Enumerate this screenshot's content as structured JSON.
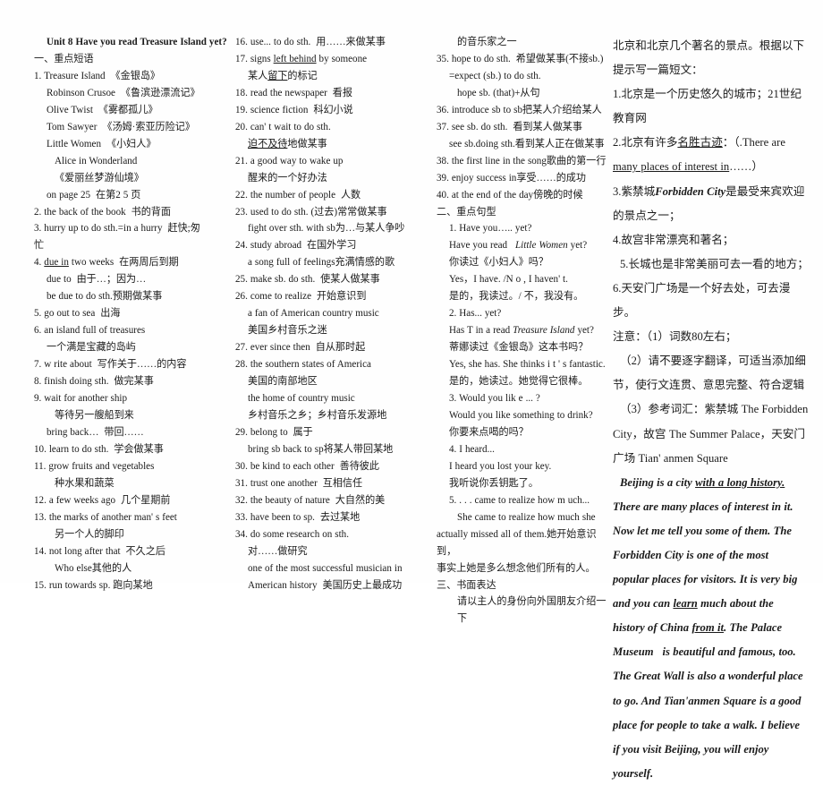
{
  "document": {
    "title": "Unit 8 Have you read Treasure Island yet?",
    "type": "english-study-notes",
    "language": "en-zh"
  },
  "col1": {
    "lines": [
      {
        "id": "l1",
        "text": "Unit 8 Have you read Treasure Island yet?",
        "style": "bold",
        "indent": 1
      },
      {
        "id": "l2",
        "text": "一、重点短语"
      },
      {
        "id": "l3",
        "text": "1. Treasure Island  《金银岛》"
      },
      {
        "id": "l4",
        "text": "Robinson Crusoe  《鲁滨逊漂流记》",
        "indent": 1
      },
      {
        "id": "l5",
        "text": "Olive Twist  《雾都孤儿》",
        "indent": 1
      },
      {
        "id": "l6",
        "text": "Tom Sawyer  《汤姆·索亚历险记》",
        "indent": 1
      },
      {
        "id": "l7",
        "text": "Little Women  《小妇人》",
        "indent": 1
      },
      {
        "id": "l8",
        "text": "Alice in Wonderland",
        "indent": 2
      },
      {
        "id": "l9",
        "text": "《爱丽丝梦游仙境》",
        "indent": 2
      },
      {
        "id": "l10",
        "text": "on page 25  在第2 5 页",
        "indent": 1
      },
      {
        "id": "l11",
        "text": "2. the back of the book  书的背面"
      },
      {
        "id": "l12",
        "text": "3. hurry up to do sth.=in a hurry  赶快;匆"
      },
      {
        "id": "l13",
        "text": "忙"
      },
      {
        "id": "l14",
        "text": "4. due in two weeks  在两周后到期",
        "underline_part": "due in"
      },
      {
        "id": "l15",
        "text": "due to  由于…；因为…",
        "indent": 1
      },
      {
        "id": "l16",
        "text": "be due to do sth.预期做某事",
        "indent": 1
      },
      {
        "id": "l17",
        "text": "5. go out to sea  出海"
      },
      {
        "id": "l18",
        "text": "6. an island full of treasures"
      },
      {
        "id": "l19",
        "text": "一个满是宝藏的岛屿",
        "indent": 1
      },
      {
        "id": "l20",
        "text": "7. w rite about  写作关于……的内容"
      },
      {
        "id": "l21",
        "text": "8. finish doing sth.  做完某事"
      },
      {
        "id": "l22",
        "text": "9. wait for another ship"
      },
      {
        "id": "l23",
        "text": "等待另一艘船到来",
        "indent": 2
      },
      {
        "id": "l24",
        "text": "bring back…  带回……",
        "indent": 1
      },
      {
        "id": "l25",
        "text": "10. learn to do sth.  学会做某事"
      },
      {
        "id": "l26",
        "text": "11. grow fruits and vegetables"
      },
      {
        "id": "l27",
        "text": "种水果和蔬菜",
        "indent": 2
      },
      {
        "id": "l28",
        "text": "12. a few weeks ago  几个星期前"
      },
      {
        "id": "l29",
        "text": "13. the marks of another man' s feet"
      },
      {
        "id": "l30",
        "text": "另一个人的脚印",
        "indent": 2
      },
      {
        "id": "l31",
        "text": "14. not long after that  不久之后"
      },
      {
        "id": "l32",
        "text": "Who else其他的人",
        "indent": 2
      },
      {
        "id": "l33",
        "text": "15. run towards sp. 跑向某地"
      }
    ]
  },
  "col2": {
    "lines": [
      {
        "id": "m1",
        "text": "16. use... to do sth.  用……来做某事"
      },
      {
        "id": "m2",
        "text": "17. signs left behind by someone",
        "underline_part": "left behind"
      },
      {
        "id": "m3",
        "text": "某人留下的标记",
        "indent": 1,
        "underline_part": "留下"
      },
      {
        "id": "m4",
        "text": "18. read the newspaper  看报"
      },
      {
        "id": "m5",
        "text": "19. science fiction  科幻小说"
      },
      {
        "id": "m6",
        "text": "20. can' t wait to do sth."
      },
      {
        "id": "m7",
        "text": "迫不及待地做某事",
        "indent": 1,
        "underline_part": "迫不及待"
      },
      {
        "id": "m8",
        "text": "21. a good way to wake up"
      },
      {
        "id": "m9",
        "text": "醒来的一个好办法",
        "indent": 1
      },
      {
        "id": "m10",
        "text": "22. the number of people  人数"
      },
      {
        "id": "m11",
        "text": "23. used to do sth. (过去)常常做某事"
      },
      {
        "id": "m12",
        "text": "fight over sth. with sb为…与某人争吵",
        "indent": 1
      },
      {
        "id": "m13",
        "text": "24. study abroad  在国外学习"
      },
      {
        "id": "m14",
        "text": "a song full of feelings充满情感的歌",
        "indent": 1
      },
      {
        "id": "m15",
        "text": "25. make sb. do sth.  使某人做某事"
      },
      {
        "id": "m16",
        "text": "26. come to realize  开始意识到"
      },
      {
        "id": "m17",
        "text": "a fan of American country music",
        "indent": 1
      },
      {
        "id": "m18",
        "text": "美国乡村音乐之迷",
        "indent": 1
      },
      {
        "id": "m19",
        "text": "27. ever since then  自从那时起"
      },
      {
        "id": "m20",
        "text": "28. the southern states of America"
      },
      {
        "id": "m21",
        "text": "美国的南部地区",
        "indent": 1
      },
      {
        "id": "m22",
        "text": "the home of country music",
        "indent": 1
      },
      {
        "id": "m23",
        "text": "乡村音乐之乡；乡村音乐发源地",
        "indent": 1
      },
      {
        "id": "m24",
        "text": "29. belong to  属于"
      },
      {
        "id": "m25",
        "text": "bring sb back to sp将某人带回某地",
        "indent": 1
      },
      {
        "id": "m26",
        "text": "30. be kind to each other  善待彼此"
      },
      {
        "id": "m27",
        "text": "31. trust one another  互相信任"
      },
      {
        "id": "m28",
        "text": "32. the beauty of nature  大自然的美"
      },
      {
        "id": "m29",
        "text": "33. have been to sp.  去过某地"
      },
      {
        "id": "m30",
        "text": "34. do some research on sth."
      },
      {
        "id": "m31",
        "text": "对……做研究",
        "indent": 1
      },
      {
        "id": "m32",
        "text": "one of the most successful musician in",
        "indent": 1
      },
      {
        "id": "m33",
        "text": "American history  美国历史上最成功",
        "indent": 1
      }
    ]
  },
  "col3": {
    "lines": [
      {
        "id": "n1",
        "text": "的音乐家之一",
        "indent": 2
      },
      {
        "id": "n2",
        "text": "35. hope to do sth.  希望做某事(不接sb.)"
      },
      {
        "id": "n3",
        "text": "=expect (sb.) to do sth.",
        "indent": 1
      },
      {
        "id": "n4",
        "text": "hope sb. (that)+从句",
        "indent": 2
      },
      {
        "id": "n5",
        "text": "36. introduce sb to sb把某人介绍给某人"
      },
      {
        "id": "n6",
        "text": "37. see sb. do sth.  看到某人做某事"
      },
      {
        "id": "n7",
        "text": "see sb.doing sth.看到某人正在做某事",
        "indent": 1
      },
      {
        "id": "n8",
        "text": "38. the first line in the song歌曲的第一行"
      },
      {
        "id": "n9",
        "text": "39. enjoy success in享受……的成功"
      },
      {
        "id": "n10",
        "text": "40. at the end of the day傍晚的时候"
      },
      {
        "id": "n11",
        "text": "二、重点句型"
      },
      {
        "id": "n12",
        "text": "1. Have you….. yet?",
        "indent": 1
      },
      {
        "id": "n13",
        "text": "Have you read   Little Women yet?",
        "indent": 1,
        "italic_part": "Little Women"
      },
      {
        "id": "n14",
        "text": "你读过《小妇人》吗？",
        "indent": 1
      },
      {
        "id": "n15",
        "text": "Yes，I have. /N o , I haven' t.",
        "indent": 1
      },
      {
        "id": "n16",
        "text": "是的，我读过。/ 不，我没有。",
        "indent": 1
      },
      {
        "id": "n17",
        "text": "2. Has... yet?",
        "indent": 1
      },
      {
        "id": "n18",
        "text": "Has T in a read Treasure Island yet?",
        "indent": 1,
        "italic_part": "Treasure Island"
      },
      {
        "id": "n19",
        "text": "蒂娜读过《金银岛》这本书吗？",
        "indent": 1
      },
      {
        "id": "n20",
        "text": "Yes, she has. She thinks i t ' s fantastic.",
        "indent": 1
      },
      {
        "id": "n21",
        "text": "是的，她读过。她觉得它很棒。",
        "indent": 1
      },
      {
        "id": "n22",
        "text": "3. Would you lik e ... ?",
        "indent": 1
      },
      {
        "id": "n23",
        "text": "Would you like something to drink?",
        "indent": 1
      },
      {
        "id": "n24",
        "text": "你要来点喝的吗？",
        "indent": 1
      },
      {
        "id": "n25",
        "text": "4. I heard...",
        "indent": 1
      },
      {
        "id": "n26",
        "text": "I heard you lost your key.",
        "indent": 1
      },
      {
        "id": "n27",
        "text": "我听说你丢钥匙了。",
        "indent": 1
      },
      {
        "id": "n28",
        "text": "5. . . . came to realize how m uch...",
        "indent": 1
      },
      {
        "id": "n29",
        "text": "She came to realize how much she",
        "indent": 2
      },
      {
        "id": "n30",
        "text": "actually missed all of them.她开始意识到，"
      },
      {
        "id": "n31",
        "text": "事实上她是多么想念他们所有的人。"
      },
      {
        "id": "n32",
        "text": "三、书面表达"
      },
      {
        "id": "n33",
        "text": "请以主人的身份向外国朋友介绍一下",
        "indent": 2
      }
    ]
  },
  "col4": {
    "lines": [
      {
        "id": "p1",
        "text": "北京和北京几个著名的景点。根据以下"
      },
      {
        "id": "p2",
        "text": "提示写一篇短文："
      },
      {
        "id": "p3",
        "text": "1.北京是一个历史悠久的城市；21世纪"
      },
      {
        "id": "p4",
        "text": "教育网"
      },
      {
        "id": "p5",
        "text": "2.北京有许多名胜古迹：（.There are",
        "underline_part": "名胜古迹"
      },
      {
        "id": "p6",
        "text": "many places of interest in……）",
        "underline_part": "many places of interest in"
      },
      {
        "id": "p7",
        "text": "3.紫禁城Forbidden City是最受来宾欢迎",
        "bolditalic_part": "Forbidden City"
      },
      {
        "id": "p8",
        "text": "的景点之一；"
      },
      {
        "id": "p9",
        "text": "4.故宫非常漂亮和著名；"
      },
      {
        "id": "p10",
        "text": "5.长城也是非常美丽可去一看的地方；",
        "indent": 3
      },
      {
        "id": "p11",
        "text": "6.天安门广场是一个好去处，可去漫步。"
      },
      {
        "id": "p12",
        "text": "注意：（1）词数80左右；"
      },
      {
        "id": "p13",
        "text": "（2）请不要逐字翻译，可适当添加细",
        "indent": 3
      },
      {
        "id": "p14",
        "text": "节，使行文连贯、意思完整、符合逻辑"
      },
      {
        "id": "p15",
        "text": "（3）参考词汇：紫禁城 The Forbidden",
        "indent": 3
      },
      {
        "id": "p16",
        "text": "City，故宫 The Summer Palace，天安门"
      },
      {
        "id": "p17",
        "text": "广场 Tian' anmen Square"
      },
      {
        "id": "p18",
        "text": "Beijing is a city with a long history.",
        "style": "bolditalic",
        "indent": 3,
        "underline_part": "with a long history."
      },
      {
        "id": "p19",
        "text": "There are many places of interest in it.",
        "style": "bolditalic"
      },
      {
        "id": "p20",
        "text": "Now let me tell you some of them. The",
        "style": "bolditalic"
      },
      {
        "id": "p21",
        "text": "Forbidden City is one of the most",
        "style": "bolditalic"
      },
      {
        "id": "p22",
        "text": "popular places for visitors. It is very big",
        "style": "bolditalic"
      },
      {
        "id": "p23",
        "text": "and you can learn much about the",
        "style": "bolditalic",
        "underline_part": "learn"
      },
      {
        "id": "p24",
        "text": "history of China from it. The Palace",
        "style": "bolditalic",
        "underline_part": "from it"
      },
      {
        "id": "p25",
        "text": "Museum   is beautiful and famous, too.",
        "style": "bolditalic"
      },
      {
        "id": "p26",
        "text": "The Great Wall is also a wonderful place",
        "style": "bolditalic"
      },
      {
        "id": "p27",
        "text": "to go. And Tian'anmen Square is a good",
        "style": "bolditalic"
      },
      {
        "id": "p28",
        "text": "place for people to take a walk. I believe",
        "style": "bolditalic"
      },
      {
        "id": "p29",
        "text": "if you visit Beijing, you will enjoy",
        "style": "bolditalic"
      },
      {
        "id": "p30",
        "text": "yourself.",
        "style": "bolditalic"
      }
    ]
  }
}
